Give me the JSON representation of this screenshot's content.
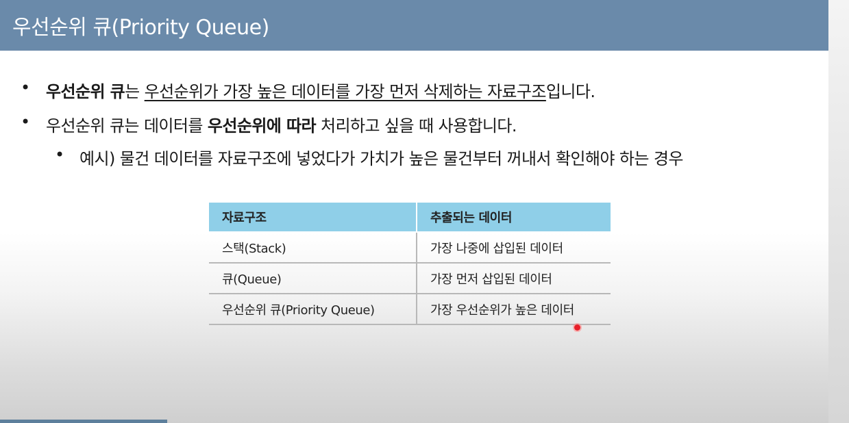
{
  "slide": {
    "title": "우선순위 큐(Priority Queue)",
    "bullets": [
      {
        "marker": "•",
        "bold": "우선순위 큐",
        "text1": "는 ",
        "underlined": "우선순위가 가장 높은 데이터를 가장 먼저 삭제하는 자료구조",
        "text2": "입니다."
      },
      {
        "marker": "•",
        "text1": "우선순위 큐는 데이터를 ",
        "bold": "우선순위에 따라",
        "text2": " 처리하고 싶을 때 사용합니다."
      },
      {
        "marker": "•",
        "text": "예시) 물건 데이터를 자료구조에 넣었다가 가치가 높은 물건부터 꺼내서 확인해야 하는 경우"
      }
    ],
    "table": {
      "headers": [
        "자료구조",
        "추출되는 데이터"
      ],
      "rows": [
        [
          "스택(Stack)",
          "가장 나중에 삽입된 데이터"
        ],
        [
          "큐(Queue)",
          "가장 먼저 삽입된 데이터"
        ],
        [
          "우선순위 큐(Priority Queue)",
          "가장 우선순위가 높은 데이터"
        ]
      ]
    }
  },
  "colors": {
    "title_bar": "#6a8aaa",
    "table_header": "#8fcfe8",
    "laser_pointer": "#e8202a"
  }
}
